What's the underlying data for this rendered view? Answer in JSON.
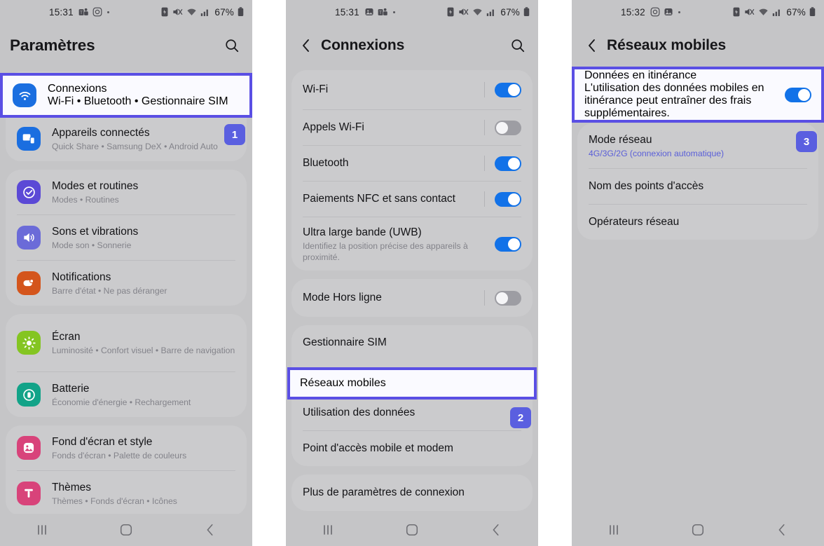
{
  "panels": [
    {
      "id": "settings",
      "status": {
        "time": "15:31",
        "battery": "67%"
      },
      "appbar": {
        "title": "Paramètres",
        "has_back": false,
        "has_search": true
      },
      "highlight": {
        "title": "Connexions",
        "subtitle": "Wi-Fi • Bluetooth • Gestionnaire SIM"
      },
      "items": [
        {
          "title": "Appareils connectés",
          "subtitle": "Quick Share • Samsung DeX • Android Auto",
          "color": "#1a6ee0",
          "icon": "devices-icon",
          "badge": "1"
        },
        {
          "title": "Modes et routines",
          "subtitle": "Modes • Routines",
          "color": "#5b49d6",
          "icon": "modes-icon"
        },
        {
          "title": "Sons et vibrations",
          "subtitle": "Mode son • Sonnerie",
          "color": "#6b6bd8",
          "icon": "sound-icon"
        },
        {
          "title": "Notifications",
          "subtitle": "Barre d'état • Ne pas déranger",
          "color": "#d4551c",
          "icon": "notification-icon"
        },
        {
          "title": "Écran",
          "subtitle": "Luminosité • Confort visuel • Barre de navigation",
          "color": "#84c522",
          "icon": "display-icon"
        },
        {
          "title": "Batterie",
          "subtitle": "Économie d'énergie • Rechargement",
          "color": "#12a388",
          "icon": "battery-icon"
        },
        {
          "title": "Fond d'écran et style",
          "subtitle": "Fonds d'écran • Palette de couleurs",
          "color": "#d8437a",
          "icon": "wallpaper-icon"
        },
        {
          "title": "Thèmes",
          "subtitle": "Thèmes • Fonds d'écran • Icônes",
          "color": "#d8437a",
          "icon": "themes-icon"
        }
      ]
    },
    {
      "id": "connexions",
      "status": {
        "time": "15:31",
        "battery": "67%"
      },
      "appbar": {
        "title": "Connexions",
        "has_back": true,
        "has_search": true
      },
      "items": [
        {
          "title": "Wi-Fi",
          "toggle": "on"
        },
        {
          "title": "Appels Wi-Fi",
          "toggle": "off"
        },
        {
          "title": "Bluetooth",
          "toggle": "on"
        },
        {
          "title": "Paiements NFC et sans contact",
          "toggle": "on"
        },
        {
          "title": "Ultra large bande (UWB)",
          "subtitle": "Identifiez la position précise des appareils à proximité.",
          "toggle": "on"
        },
        {
          "title": "Mode Hors ligne",
          "toggle": "off"
        },
        {
          "title": "Gestionnaire SIM"
        },
        {
          "title": "Utilisation des données",
          "badge": "2"
        },
        {
          "title": "Point d'accès mobile et modem"
        },
        {
          "title": "Plus de paramètres de connexion"
        }
      ],
      "highlight": {
        "title": "Réseaux mobiles"
      }
    },
    {
      "id": "reseaux-mobiles",
      "status": {
        "time": "15:32",
        "battery": "67%"
      },
      "appbar": {
        "title": "Réseaux mobiles",
        "has_back": true,
        "has_search": false
      },
      "highlight": {
        "title": "Données en itinérance",
        "subtitle": "L'utilisation des données mobiles en itinérance peut entraîner des frais supplémentaires.",
        "toggle": "on"
      },
      "items": [
        {
          "title": "Mode réseau",
          "subtitle": "4G/3G/2G (connexion automatique)",
          "subtitle_link": true,
          "badge": "3"
        },
        {
          "title": "Nom des points d'accès"
        },
        {
          "title": "Opérateurs réseau"
        }
      ]
    }
  ],
  "navbar": {
    "recents": "recents-icon",
    "home": "home-icon",
    "back": "back-icon"
  },
  "colors": {
    "highlight_border": "#5a4fe4",
    "badge_bg": "#5a5fe0",
    "toggle_on": "#1272e8",
    "link": "#5a5fd8"
  }
}
